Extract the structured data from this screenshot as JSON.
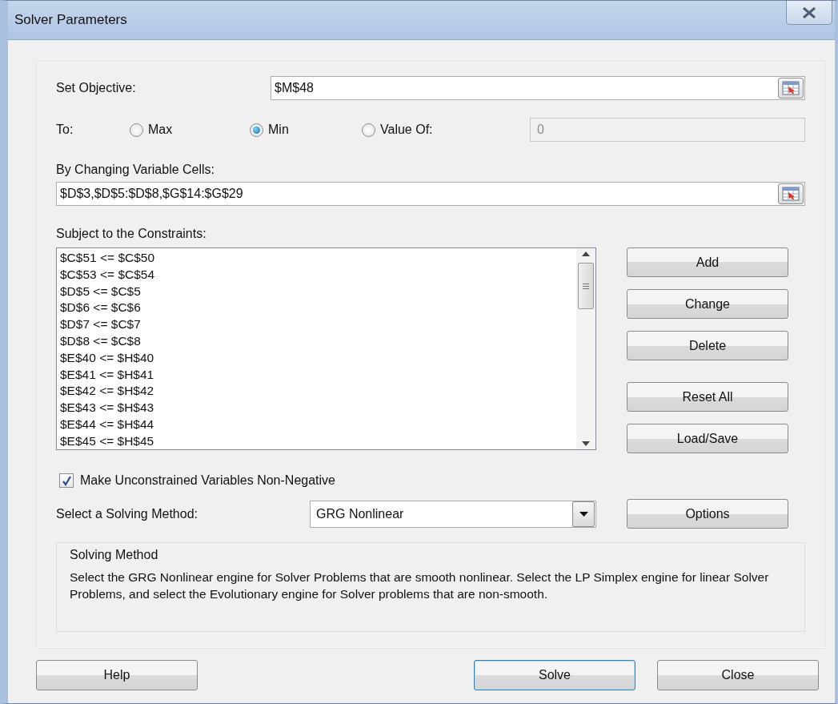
{
  "window": {
    "title": "Solver Parameters"
  },
  "objective": {
    "label": "Set Objective:",
    "value": "$M$48"
  },
  "to": {
    "label": "To:",
    "options": [
      {
        "label": "Max",
        "selected": false
      },
      {
        "label": "Min",
        "selected": true
      },
      {
        "label": "Value Of:",
        "selected": false
      }
    ],
    "value_field": {
      "value": "0",
      "disabled": true
    }
  },
  "variables": {
    "label": "By Changing Variable Cells:",
    "value": "$D$3,$D$5:$D$8,$G$14:$G$29"
  },
  "constraints": {
    "label": "Subject to the Constraints:",
    "items": [
      "$C$51 <= $C$50",
      "$C$53 <= $C$54",
      "$D$5 <= $C$5",
      "$D$6 <= $C$6",
      "$D$7 <= $C$7",
      "$D$8 <= $C$8",
      "$E$40 <= $H$40",
      "$E$41 <= $H$41",
      "$E$42 <= $H$42",
      "$E$43 <= $H$43",
      "$E$44 <= $H$44",
      "$E$45 <= $H$45"
    ]
  },
  "constraint_buttons": [
    "Add",
    "Change",
    "Delete",
    "Reset All",
    "Load/Save"
  ],
  "non_negative": {
    "label": "Make Unconstrained Variables Non-Negative",
    "checked": true
  },
  "method": {
    "label": "Select a Solving Method:",
    "value": "GRG Nonlinear"
  },
  "options_button": "Options",
  "description": {
    "title": "Solving Method",
    "text": "Select the GRG Nonlinear engine for Solver Problems that are smooth nonlinear. Select the LP Simplex engine for linear Solver Problems, and select the Evolutionary engine for Solver problems that are non-smooth."
  },
  "footer_buttons": [
    {
      "label": "Help",
      "focused": false
    },
    {
      "label": "Solve",
      "focused": true
    },
    {
      "label": "Close",
      "focused": false
    }
  ]
}
